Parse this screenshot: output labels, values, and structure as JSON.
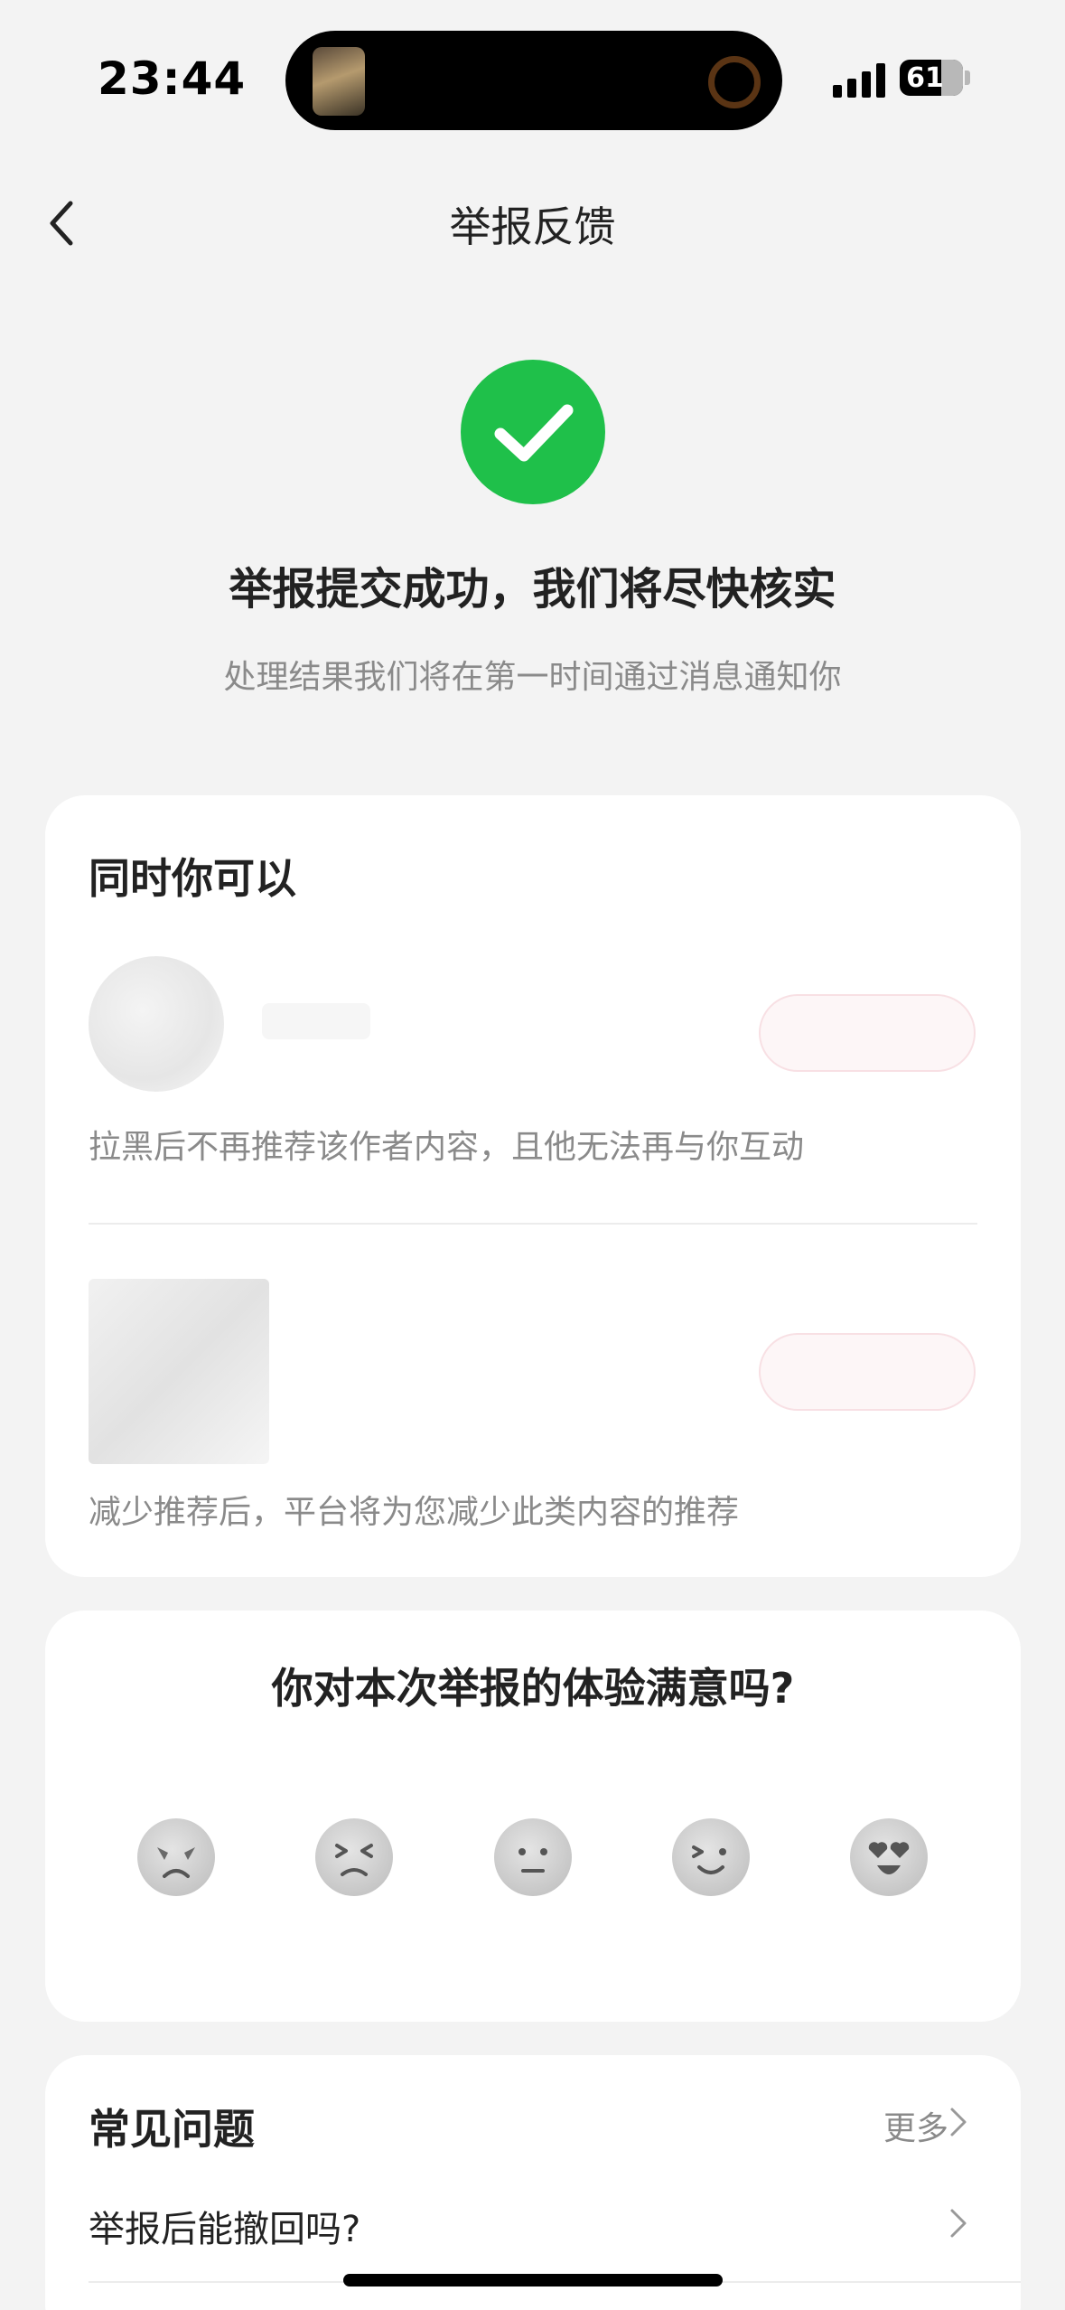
{
  "status_bar": {
    "time": "23:44",
    "battery": "61"
  },
  "nav": {
    "title": "举报反馈"
  },
  "success": {
    "title": "举报提交成功，我们将尽快核实",
    "subtitle": "处理结果我们将在第一时间通过消息通知你"
  },
  "actions": {
    "title": "同时你可以",
    "items": [
      {
        "description": "拉黑后不再推荐该作者内容，且他无法再与你互动"
      },
      {
        "description": "减少推荐后，平台将为您减少此类内容的推荐"
      }
    ]
  },
  "rating": {
    "title": "你对本次举报的体验满意吗?",
    "options": [
      "very-dissatisfied-face-icon",
      "dissatisfied-face-icon",
      "neutral-face-icon",
      "satisfied-face-icon",
      "very-satisfied-face-icon"
    ]
  },
  "faq": {
    "title": "常见问题",
    "more": "更多",
    "questions": [
      "举报后能撤回吗?"
    ]
  },
  "colors": {
    "success_green": "#1fc04a",
    "background": "#f3f3f3"
  }
}
